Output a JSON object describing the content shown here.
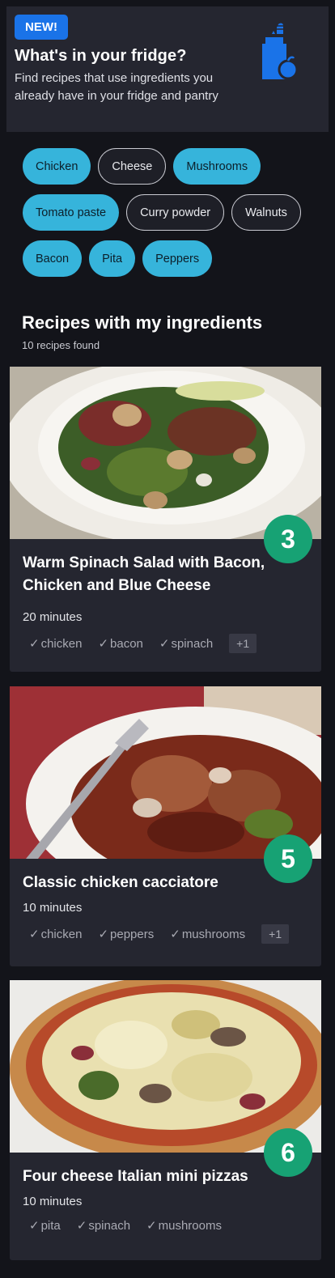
{
  "promo": {
    "badge": "NEW!",
    "title": "What's in your fridge?",
    "description": "Find recipes that use ingredients you already have in your fridge and pantry",
    "icon": "grocery-bag-icon"
  },
  "ingredients": [
    [
      {
        "label": "Chicken",
        "selected": true
      },
      {
        "label": "Cheese",
        "selected": false
      },
      {
        "label": "Mushrooms",
        "selected": true
      }
    ],
    [
      {
        "label": "Tomato paste",
        "selected": true
      },
      {
        "label": "Curry powder",
        "selected": false
      },
      {
        "label": "Walnuts",
        "selected": false
      }
    ],
    [
      {
        "label": "Bacon",
        "selected": true
      },
      {
        "label": "Pita",
        "selected": true
      },
      {
        "label": "Peppers",
        "selected": true
      }
    ]
  ],
  "results": {
    "title": "Recipes with my ingredients",
    "count_text": "10 recipes found"
  },
  "recipes": [
    {
      "score": "3",
      "title": "Warm Spinach Salad with Bacon, Chicken and Blue Cheese",
      "time": "20 minutes",
      "tags": [
        "chicken",
        "bacon",
        "spinach"
      ],
      "more": "+1"
    },
    {
      "score": "5",
      "title": "Classic chicken cacciatore",
      "time": "10 minutes",
      "tags": [
        "chicken",
        "peppers",
        "mushrooms"
      ],
      "more": "+1"
    },
    {
      "score": "6",
      "title": "Four cheese Italian mini pizzas",
      "time": "10 minutes",
      "tags": [
        "pita",
        "spinach",
        "mushrooms"
      ],
      "more": ""
    }
  ],
  "colors": {
    "background": "#13141a",
    "panel": "#252630",
    "badge": "#1a73e8",
    "chip_selected": "#36b4db",
    "score": "#17a274"
  }
}
